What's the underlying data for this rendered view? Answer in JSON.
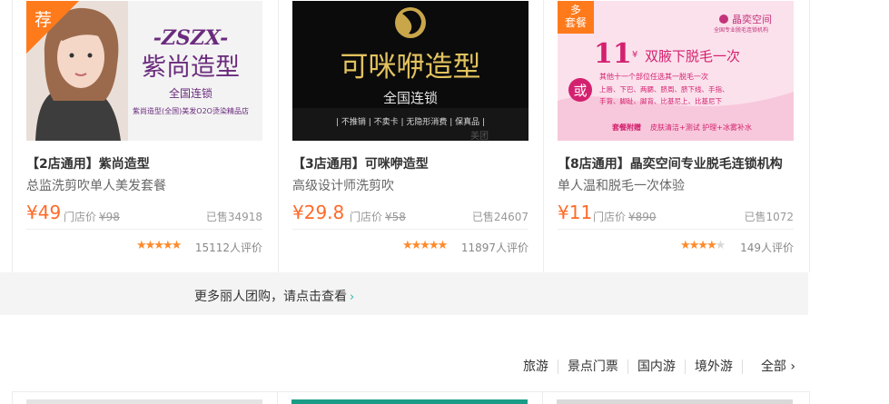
{
  "deals": [
    {
      "badge": "荐",
      "image": {
        "logo": "-ZSZX-",
        "name": "紫尚造型",
        "sub": "全国连锁",
        "caption": "紫尚造型(全国)美发O2O烫染精品店"
      },
      "title": "【2店通用】紫尚造型",
      "subtitle": "总监洗剪吹单人美发套餐",
      "price": "¥49",
      "orig_label": "门店价",
      "orig_price": "¥98",
      "sold": "已售34918",
      "stars": 4.5,
      "rating_count": "15112人评价"
    },
    {
      "image": {
        "name": "可咪咿造型",
        "sub": "全国连锁",
        "tags": "| 不推销 | 不卖卡 | 无隐形消费 | 保真品 |",
        "watermark": "美团"
      },
      "title": "【3店通用】可咪咿造型",
      "subtitle": "高级设计师洗剪吹",
      "price": "¥29.8",
      "orig_label": "门店价",
      "orig_price": "¥58",
      "sold": "已售24607",
      "stars": 5,
      "rating_count": "11897人评价"
    },
    {
      "badge": "多\n套餐",
      "image": {
        "brand": "晶奕空间",
        "brand_sub": "全国专业脱毛连锁机构",
        "price": "11",
        "unit": "¥",
        "headline": "双腋下脱毛一次",
        "alt": "或",
        "alt_head": "其他十一个部位任选其一脱毛一次",
        "parts1": "上唇、下巴、两腮、脐周、脐下线、手指、",
        "parts2": "手背、脚趾、脚背、比基尼上、比基尼下",
        "gift_label": "套餐附赠",
        "gift": "皮肤清洁+测试 护理+冰雾补水"
      },
      "title": "【8店通用】晶奕空间专业脱毛连锁机构",
      "subtitle": "单人温和脱毛一次体验",
      "price": "¥11",
      "orig_label": "门店价",
      "orig_price": "¥890",
      "sold": "已售1072",
      "stars": 4,
      "rating_count": "149人评价"
    }
  ],
  "more": {
    "label": "更多丽人团购，请点击查看",
    "arrow": "›"
  },
  "categories": [
    "旅游",
    "景点门票",
    "国内游",
    "境外游"
  ],
  "all_label": "全部",
  "all_arrow": "›",
  "colors": {
    "price": "#ff6a28",
    "badge": "#ff7a1b",
    "star": "#ff8a2a",
    "link_arrow": "#2bb8aa"
  }
}
